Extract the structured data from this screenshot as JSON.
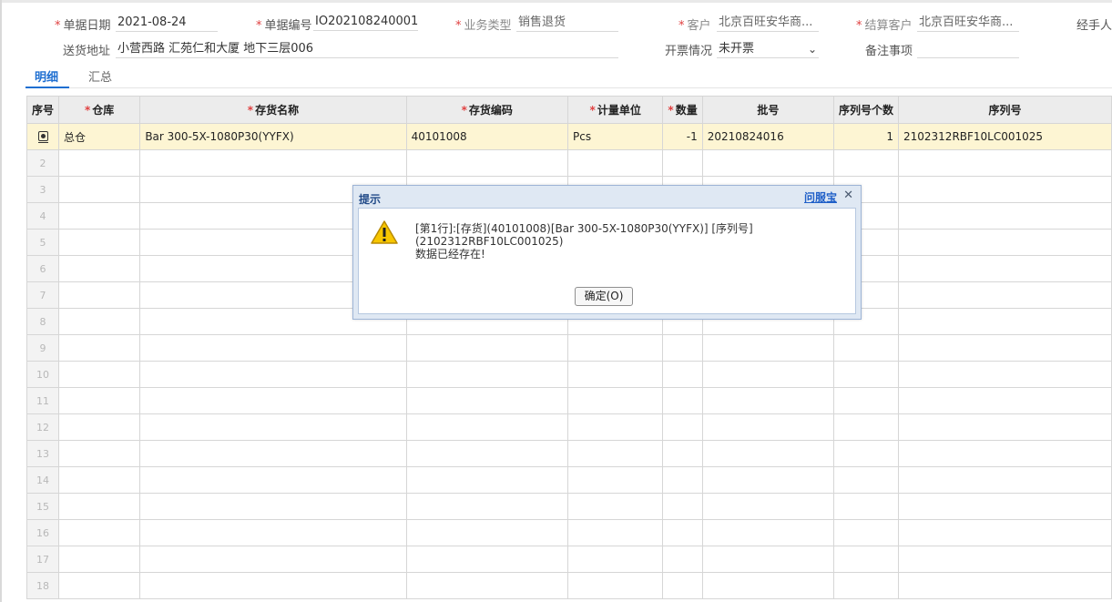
{
  "form": {
    "date": {
      "label": "单据日期",
      "value": "2021-08-24"
    },
    "doc_no": {
      "label": "单据编号",
      "value": "IO202108240001"
    },
    "biz_type": {
      "label": "业务类型",
      "value": "销售退货"
    },
    "customer": {
      "label": "客户",
      "value": "北京百旺安华商..."
    },
    "settle_customer": {
      "label": "结算客户",
      "value": "北京百旺安华商..."
    },
    "handler": {
      "label": "经手人"
    },
    "address": {
      "label": "送货地址",
      "value": "小营西路  汇苑仁和大厦 地下三层006"
    },
    "invoice": {
      "label": "开票情况",
      "value": "未开票"
    },
    "remark": {
      "label": "备注事项",
      "value": ""
    }
  },
  "tabs": [
    {
      "label": "明细"
    },
    {
      "label": "汇总"
    }
  ],
  "grid": {
    "headers": [
      "序号",
      "仓库",
      "存货名称",
      "存货编码",
      "计量单位",
      "数量",
      "批号",
      "序列号个数",
      "序列号"
    ],
    "row1": {
      "warehouse": "总仓",
      "name": "Bar 300-5X-1080P30(YYFX)",
      "code": "40101008",
      "unit": "Pcs",
      "qty": "-1",
      "batch": "20210824016",
      "serial_count": "1",
      "serial": "2102312RBF10LC001025"
    },
    "empty_rows": [
      "2",
      "3",
      "4",
      "5",
      "6",
      "7",
      "8",
      "9",
      "10",
      "11",
      "12",
      "13",
      "14",
      "15",
      "16",
      "17",
      "18"
    ]
  },
  "dialog": {
    "title": "提示",
    "help_link": "问服宝",
    "message_line1": "[第1行]:[存货](40101008)[Bar 300-5X-1080P30(YYFX)] [序列号]",
    "message_line2": "(2102312RBF10LC001025)",
    "message_line3": "数据已经存在!",
    "ok_button": "确定(O)"
  },
  "icons": {
    "close": "close-icon",
    "warning": "warning-icon",
    "row": "row-detail-icon"
  },
  "colors": {
    "accent": "#1f6fd1",
    "required": "#e04040",
    "negative": "#e03030",
    "selected_row": "#fdf5d3"
  }
}
